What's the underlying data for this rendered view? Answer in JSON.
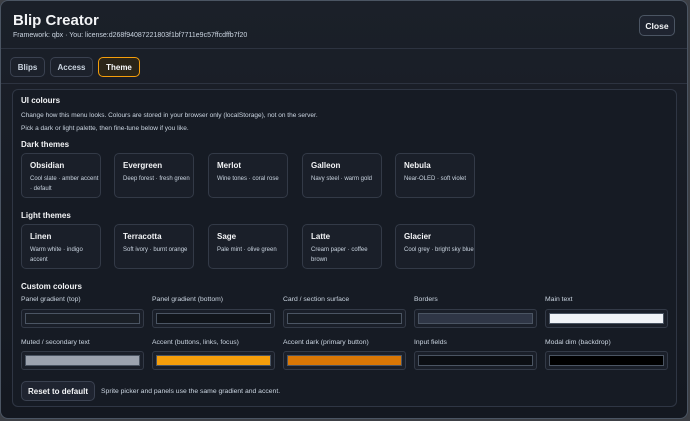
{
  "window": {
    "title": "Blip Creator",
    "subtitle": "Framework: qbx · You: license:d268f94087221803f1bf7711e9c57ffcdffb7f20",
    "close_label": "Close"
  },
  "tabs": [
    {
      "label": "Blips",
      "active": false
    },
    {
      "label": "Access",
      "active": false
    },
    {
      "label": "Theme",
      "active": true
    }
  ],
  "section": {
    "title": "UI colours",
    "desc1": "Change how this menu looks. Colours are stored in your browser only (localStorage), not on the server.",
    "desc2": "Pick a dark or light palette, then fine-tune below if you like."
  },
  "dark_themes": {
    "heading": "Dark themes",
    "items": [
      {
        "name": "Obsidian",
        "desc": "Cool slate · amber accent · default"
      },
      {
        "name": "Evergreen",
        "desc": "Deep forest · fresh green"
      },
      {
        "name": "Merlot",
        "desc": "Wine tones · coral rose"
      },
      {
        "name": "Galleon",
        "desc": "Navy steel · warm gold"
      },
      {
        "name": "Nebula",
        "desc": "Near-OLED · soft violet"
      }
    ]
  },
  "light_themes": {
    "heading": "Light themes",
    "items": [
      {
        "name": "Linen",
        "desc": "Warm white · indigo accent"
      },
      {
        "name": "Terracotta",
        "desc": "Soft ivory · burnt orange"
      },
      {
        "name": "Sage",
        "desc": "Pale mint · olive green"
      },
      {
        "name": "Latte",
        "desc": "Cream paper · coffee brown"
      },
      {
        "name": "Glacier",
        "desc": "Cool grey · bright sky blue"
      }
    ]
  },
  "custom": {
    "heading": "Custom colours",
    "fields": [
      {
        "label": "Panel gradient (top)",
        "color": "#1a1f26"
      },
      {
        "label": "Panel gradient (bottom)",
        "color": "#11151b"
      },
      {
        "label": "Card / section surface",
        "color": "#161b22"
      },
      {
        "label": "Borders",
        "color": "#2f3646"
      },
      {
        "label": "Main text",
        "color": "#f1f3f7"
      },
      {
        "label": "Muted / secondary text",
        "color": "#9ca3af"
      },
      {
        "label": "Accent (buttons, links, focus)",
        "color": "#f59e0b"
      },
      {
        "label": "Accent dark (primary button)",
        "color": "#d97706"
      },
      {
        "label": "Input fields",
        "color": "#0c0f14"
      },
      {
        "label": "Modal dim (backdrop)",
        "color": "#000000"
      }
    ]
  },
  "footer": {
    "reset_label": "Reset to default",
    "hint": "Sprite picker and panels use the same gradient and accent."
  }
}
